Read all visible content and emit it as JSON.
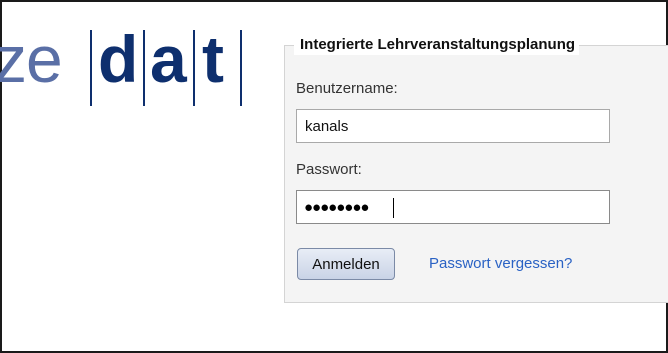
{
  "logo": {
    "part1": "ze",
    "part2": "d",
    "part3": "a",
    "part4": "t"
  },
  "login": {
    "legend": "Integrierte Lehrveranstaltungsplanung",
    "username_label": "Benutzername:",
    "username_value": "kanals",
    "password_label": "Passwort:",
    "password_mask": "●●●●●●●●",
    "submit_label": "Anmelden",
    "forgot_link": "Passwort vergessen?"
  }
}
